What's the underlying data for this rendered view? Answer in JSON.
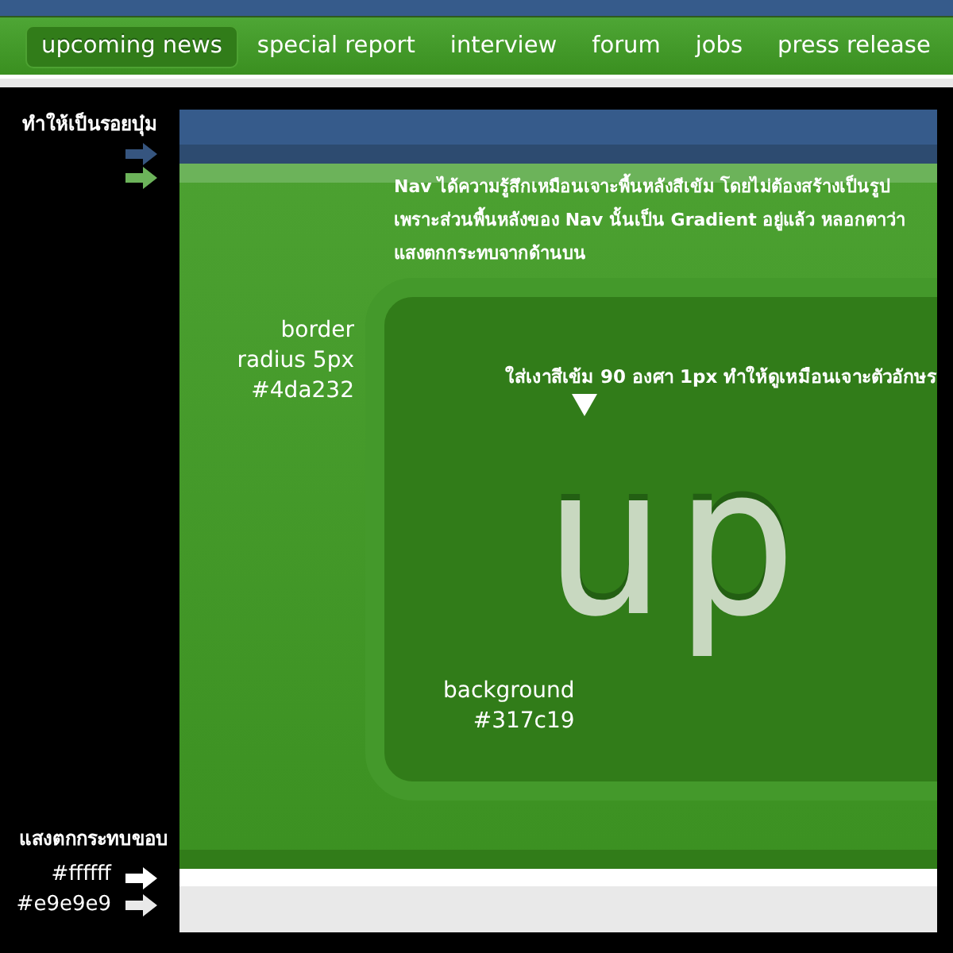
{
  "nav": {
    "items": [
      {
        "label": "upcoming news",
        "selected": true
      },
      {
        "label": "special report",
        "selected": false
      },
      {
        "label": "interview",
        "selected": false
      },
      {
        "label": "forum",
        "selected": false
      },
      {
        "label": "jobs",
        "selected": false
      },
      {
        "label": "press release",
        "selected": false
      }
    ]
  },
  "figure": {
    "top_note": "ทำให้เป็นรอยบุ๋ม",
    "description": "Nav ได้ความรู้สึกเหมือนเจาะพื้นหลังสีเข้ม โดยไม่ต้องสร้างเป็นรูป เพราะส่วนพื้นหลังของ Nav นั้นเป็น Gradient อยู่แล้ว หลอกตาว่า แสงตกกระทบจากด้านบน",
    "border_note": [
      "border",
      "radius 5px",
      "#4da232"
    ],
    "shadow_note": "ใส่เงาสีเข้ม 90 องศา 1px ทำให้ดูเหมือนเจาะตัวอักษร",
    "magnified_text": "up",
    "background_note": [
      "background",
      "#317c19"
    ],
    "bottom_note": "แสงตกกระทบขอบ",
    "edge_labels": [
      "#ffffff",
      "#e9e9e9"
    ]
  }
}
